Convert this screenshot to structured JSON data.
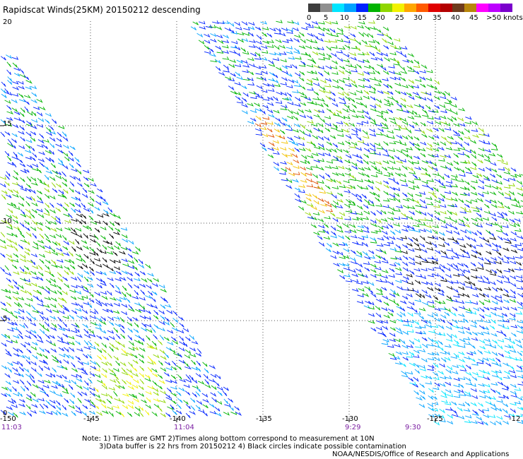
{
  "title": "Rapidscat Winds(25KM) 20150212 descending",
  "legend": {
    "labels": [
      "0",
      "5",
      "10",
      "15",
      "20",
      "25",
      "30",
      "35",
      "40",
      "45",
      ">50 knots"
    ],
    "colors": [
      "#3d3d3d",
      "#8f8f8f",
      "#00e5ff",
      "#00a2ff",
      "#0022ff",
      "#00b300",
      "#8fd600",
      "#f2f200",
      "#ffa600",
      "#ff5a00",
      "#e00000",
      "#b30000",
      "#6e3b1c",
      "#b8860b",
      "#ff00ff",
      "#bd00ff",
      "#7a00cc"
    ]
  },
  "lat_labels": [
    "20",
    "15",
    "10",
    "5",
    "0"
  ],
  "lon_labels": [
    "-150",
    "-145",
    "-140",
    "-135",
    "-130",
    "-125",
    "-12"
  ],
  "time_labels": [
    "11:03",
    "11:04",
    "9:29",
    "9:30"
  ],
  "notes": {
    "line1": "Note: 1) Times are GMT 2)Times along bottom correspond to measurement at 10N",
    "line2": "3)Data buffer is 22 hrs from 20150212 4) Black circles indicate possible contamination",
    "line3": "NOAA/NESDIS/Office of Research and Applications"
  }
}
